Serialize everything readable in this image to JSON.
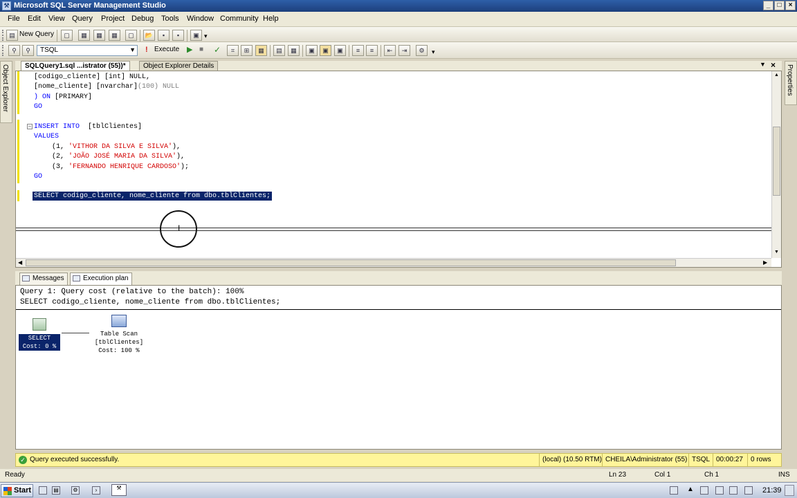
{
  "window": {
    "title": "Microsoft SQL Server Management Studio"
  },
  "menu": [
    "File",
    "Edit",
    "View",
    "Query",
    "Project",
    "Debug",
    "Tools",
    "Window",
    "Community",
    "Help"
  ],
  "toolbar": {
    "new_query": "New Query",
    "database": "TSQL",
    "execute": "Execute"
  },
  "side": {
    "left": "Object Explorer",
    "right": "Properties"
  },
  "tabs": {
    "active": "SQLQuery1.sql ...istrator (55))*",
    "inactive": "Object Explorer Details"
  },
  "code": {
    "line1": "[codigo_cliente] [int] NULL,",
    "line2a": "[nome_cliente] [nvarchar]",
    "line2b": "(100) NULL",
    "line3a": ") ON",
    "line3b": " [PRIMARY]",
    "line4": "GO",
    "line5a": "INSERT INTO",
    "line5b": "  [tblClientes]",
    "line6": "VALUES",
    "r1a": "(1, ",
    "r1b": "'VITHOR DA SILVA E SILVA'",
    "r1c": "),",
    "r2a": "(2, ",
    "r2b": "'JOÃO JOSÉ MARIA DA SILVA'",
    "r2c": "),",
    "r3a": "(3, ",
    "r3b": "'FERNANDO HENRIQUE CARDOSO'",
    "r3c": ");",
    "line8": "GO",
    "selected": "SELECT codigo_cliente, nome_cliente from dbo.tblClientes;"
  },
  "results": {
    "tab_messages": "Messages",
    "tab_plan": "Execution plan",
    "query_cost": "Query 1: Query cost (relative to the batch): 100%",
    "query_text": "SELECT codigo_cliente, nome_cliente from dbo.tblClientes;",
    "node_select": {
      "title": "SELECT",
      "cost": "Cost: 0 %"
    },
    "node_scan": {
      "title": "Table Scan",
      "table": "[tblClientes]",
      "cost": "Cost: 100 %"
    }
  },
  "query_status": {
    "message": "Query executed successfully.",
    "server": "(local) (10.50 RTM)",
    "user": "CHEILA\\Administrator (55)",
    "db": "TSQL",
    "time": "00:00:27",
    "rows": "0 rows"
  },
  "app_status": {
    "ready": "Ready",
    "ln": "Ln 23",
    "col": "Col 1",
    "ch": "Ch 1",
    "ins": "INS"
  },
  "taskbar": {
    "start": "Start",
    "clock": "21:39"
  }
}
